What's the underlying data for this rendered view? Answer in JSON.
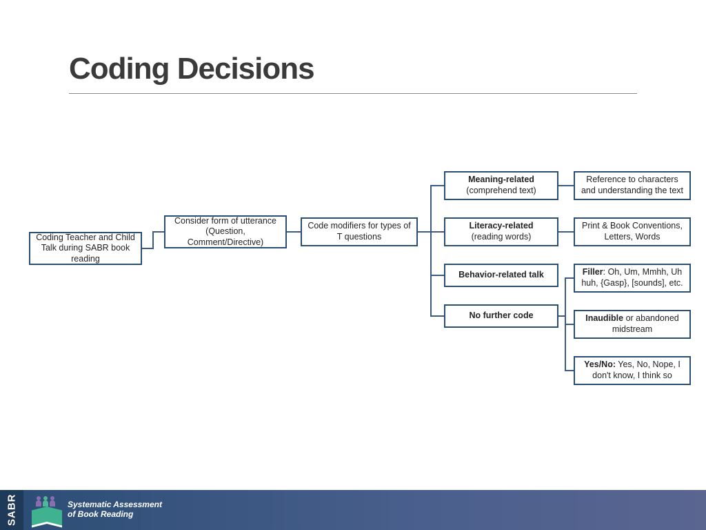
{
  "title": "Coding Decisions",
  "footer": {
    "brand": "SABR",
    "line1": "Systematic Assessment",
    "line2": "of Book Reading"
  },
  "nodes": {
    "root": {
      "text": "Coding Teacher and Child Talk during SABR book reading"
    },
    "form": {
      "text": "Consider form of utterance (Question, Comment/Directive)"
    },
    "modifiers": {
      "text": "Code modifiers for types of T questions"
    },
    "meaning": {
      "bold": "Meaning-related",
      "sub": "(comprehend text)"
    },
    "literacy": {
      "bold": "Literacy-related",
      "sub": "(reading words)"
    },
    "behavior": {
      "bold": "Behavior-related talk"
    },
    "nofurther": {
      "bold": "No further code"
    },
    "meaning_d": {
      "text": "Reference to characters and understanding the text"
    },
    "literacy_d": {
      "text": "Print & Book Conventions, Letters, Words"
    },
    "filler": {
      "bold": "Filler",
      "text": ": Oh, Um, Mmhh, Uh huh, {Gasp}, [sounds], etc."
    },
    "inaudible": {
      "bold": "Inaudible",
      "text": " or abandoned midstream"
    },
    "yesno": {
      "bold": "Yes/No:",
      "text": " Yes, No, Nope, I don't know, I think so"
    }
  }
}
